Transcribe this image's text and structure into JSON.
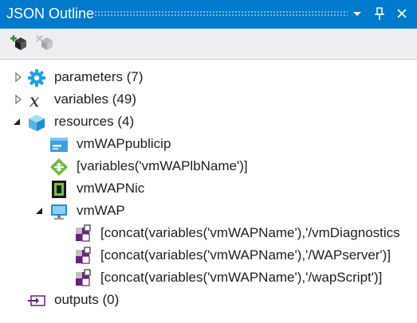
{
  "window": {
    "title": "JSON Outline",
    "dropdown_glyph": "▾",
    "pin_glyph": "⊥",
    "close_glyph": "✕"
  },
  "toolbar": {
    "add_resource_icon": "add-resource-icon",
    "remove_resource_icon": "remove-resource-icon"
  },
  "tree": {
    "parameters": {
      "label": "parameters (7)",
      "icon": "gear-icon",
      "expanded": false
    },
    "variables": {
      "label": "variables (49)",
      "icon": "variable-x-icon",
      "expanded": false
    },
    "resources": {
      "label": "resources (4)",
      "icon": "cube-icon",
      "expanded": true,
      "children": [
        {
          "label": "vmWAPpublicip",
          "icon": "public-ip-icon"
        },
        {
          "label": "[variables('vmWAPlbName')]",
          "icon": "load-balancer-icon"
        },
        {
          "label": "vmWAPNic",
          "icon": "nic-icon"
        },
        {
          "label": "vmWAP",
          "icon": "virtual-machine-icon",
          "expanded": true,
          "children": [
            {
              "label": "[concat(variables('vmWAPName'),'/vmDiagnostics",
              "icon": "extension-icon"
            },
            {
              "label": "[concat(variables('vmWAPName'),'/WAPserver')]",
              "icon": "extension-icon"
            },
            {
              "label": "[concat(variables('vmWAPName'),'/wapScript')]",
              "icon": "extension-icon"
            }
          ]
        }
      ]
    },
    "outputs": {
      "label": "outputs (0)",
      "icon": "outputs-icon"
    }
  },
  "colors": {
    "titlebar": "#007acc",
    "toolbar": "#eeeef2",
    "text": "#1e1e1e"
  }
}
